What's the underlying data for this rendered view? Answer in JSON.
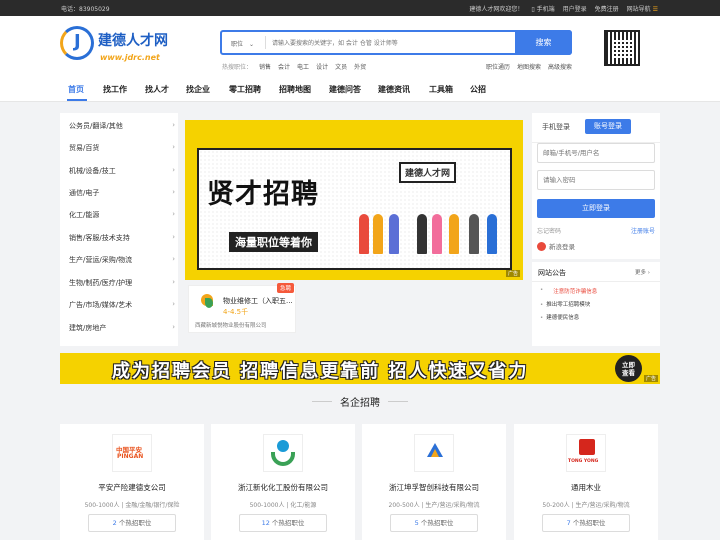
{
  "topbar": {
    "phone": "电话：83905029",
    "welcome": "建德人才网欢迎您！",
    "mobile": "手机端",
    "login": "用户登录",
    "register": "免费注册",
    "sitemap": "网站导航"
  },
  "logo": {
    "name": "建德人才网",
    "url": "www.jdrc.net",
    "mark": "J"
  },
  "search": {
    "category": "职位",
    "placeholder": "请输入要搜索的关键字，如 会计 仓管 设计师等",
    "button": "搜索",
    "hot_label": "热搜职位：",
    "hot_keywords": [
      "销售",
      "会计",
      "电工",
      "设计",
      "文员",
      "外贸"
    ],
    "links": [
      "职位通历",
      "地图搜索",
      "高级搜索"
    ]
  },
  "nav": {
    "items": [
      "首页",
      "找工作",
      "找人才",
      "找企业",
      "零工招聘",
      "招聘地图",
      "建德问答",
      "建德资讯",
      "工具箱",
      "公招"
    ]
  },
  "categories": [
    "公务员/翻译/其他",
    "贸易/百货",
    "机械/设备/技工",
    "通信/电子",
    "化工/能源",
    "销售/客服/技术支持",
    "生产/营运/采购/物流",
    "生物/制药/医疗/护理",
    "广告/市场/媒体/艺术",
    "建筑/房地产"
  ],
  "banner": {
    "headline": "贤才招聘",
    "tagline": "海量职位等着你",
    "sign": "建德人才网",
    "ad": "广告"
  },
  "featured_job": {
    "title": "物业维修工（入职五...",
    "salary": "4-4.5千",
    "company": "西藏新城悦物业股份有限公司",
    "badge": "急聘"
  },
  "login": {
    "tab_mobile": "手机登录",
    "tab_account": "账号登录",
    "username_placeholder": "邮箱/手机号/用户名",
    "password_placeholder": "请输入密码",
    "button": "立即登录",
    "forgot": "忘记密码",
    "register": "注册账号",
    "weibo": "新浪登录"
  },
  "notice": {
    "title": "网站公告",
    "more": "更多",
    "items": [
      "注意防范诈骗信息",
      "推出零工招聘模块",
      "建德便民信息"
    ]
  },
  "promo": {
    "text": "成为招聘会员 招聘信息更靠前 招人快速又省力",
    "cta_line1": "立即",
    "cta_line2": "查看",
    "ad": "广告"
  },
  "famous": {
    "title": "名企招聘",
    "jobs_suffix": "个热招职位",
    "companies": [
      {
        "name": "平安产险建德支公司",
        "size": "500-1000人",
        "industry": "金融/金融/银行/保险",
        "jobs": "2",
        "logo_text": "中国平安",
        "logo_sub": "PINGAN"
      },
      {
        "name": "浙江新化化工股份有限公司",
        "size": "500-1000人",
        "industry": "化工/能源",
        "jobs": "12",
        "logo_text": "",
        "logo_sub": ""
      },
      {
        "name": "浙江坤孚智创科技有限公司",
        "size": "200-500人",
        "industry": "生产/营运/采购/物流",
        "jobs": "5",
        "logo_text": "",
        "logo_sub": ""
      },
      {
        "name": "通用木业",
        "size": "50-200人",
        "industry": "生产/营运/采购/物流",
        "jobs": "7",
        "logo_text": "TONG YONG",
        "logo_sub": ""
      }
    ]
  },
  "colors": {
    "accent": "#3d7be8",
    "banner": "#f5d200",
    "salary": "#f2a51a"
  }
}
